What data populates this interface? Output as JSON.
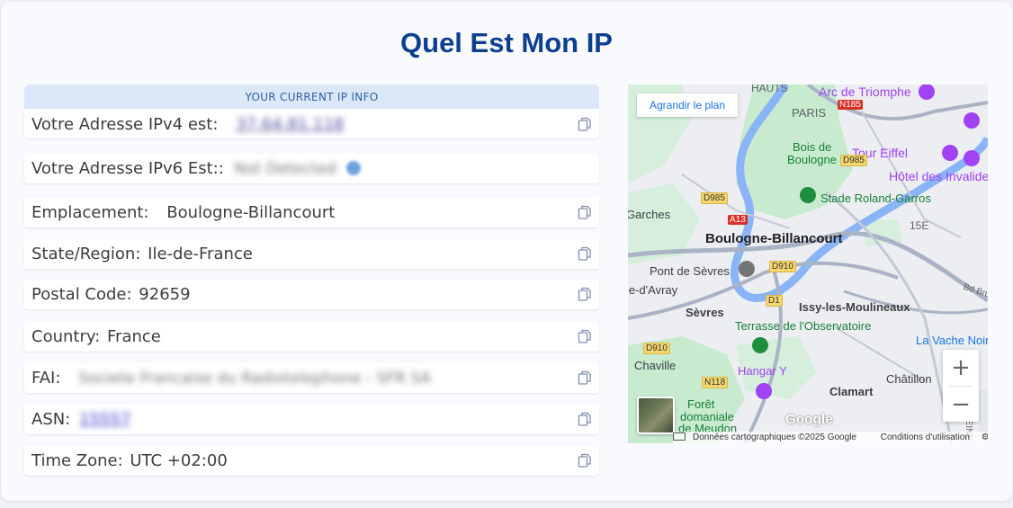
{
  "page": {
    "title": "Quel Est Mon IP"
  },
  "info": {
    "header": "YOUR CURRENT IP INFO",
    "rows": [
      {
        "label": "Votre Adresse IPv4 est:",
        "value": "37.64.81.118"
      },
      {
        "label": "Votre Adresse IPv6 Est::",
        "value": "Not Detected"
      },
      {
        "label": "Emplacement:",
        "value": "Boulogne-Billancourt"
      },
      {
        "label": "State/Region:",
        "value": "Ile-de-France"
      },
      {
        "label": "Postal Code:",
        "value": "92659"
      },
      {
        "label": "Country:",
        "value": "France"
      },
      {
        "label": "FAI:",
        "value": "Societe Francaise du Radiotelephone - SFR SA"
      },
      {
        "label": "ASN:",
        "value": "15557"
      },
      {
        "label": "Time Zone:",
        "value": "UTC +02:00"
      }
    ]
  },
  "map": {
    "enlarge_label": "Agrandir le plan",
    "zoom_in": "+",
    "zoom_out": "−",
    "google_logo": "Google",
    "attribution": "Données cartographiques ©2025 Google",
    "terms": "Conditions d'utilisation",
    "labels": {
      "hauts": "HAUTS",
      "paris": "PARIS",
      "arc": "Arc de Triomphe",
      "bois": "Bois de",
      "bois2": "Boulogne",
      "tour": "Tour Eiffel",
      "hotel": "Hôtel des Invalides",
      "roland": "Stade Roland-Garros",
      "garches": "Garches",
      "boulogne": "Boulogne-Billancourt",
      "quinze": "15E",
      "pont": "Pont de Sèvres",
      "avray": "le-d'Avray",
      "sevres": "Sèvres",
      "issy": "Issy-les-Moulineaux",
      "terrasse": "Terrasse de l'Observatoire",
      "vache": "La Vache Noire",
      "chaville": "Chaville",
      "hangar": "Hangar Y",
      "clamart": "Clamart",
      "chatillon": "Châtillon",
      "foret": "Forêt",
      "domaniale": "domaniale",
      "meudon": "de Meudon",
      "bd": "Bd Brune",
      "seine": "SEINE",
      "n185": "N185",
      "d985": "D985",
      "a13": "A13",
      "d910": "D910",
      "d1": "D1",
      "d910b": "D910",
      "n118": "N118"
    }
  },
  "colors": {
    "title": "#0d3f91",
    "header_bg": "#dce8f9",
    "map_water": "#8ab4f8",
    "map_park": "#c8ebd0",
    "copy_icon": "#7f8db0"
  },
  "icons": {
    "copy": "copy-icon",
    "info": "info-icon"
  }
}
